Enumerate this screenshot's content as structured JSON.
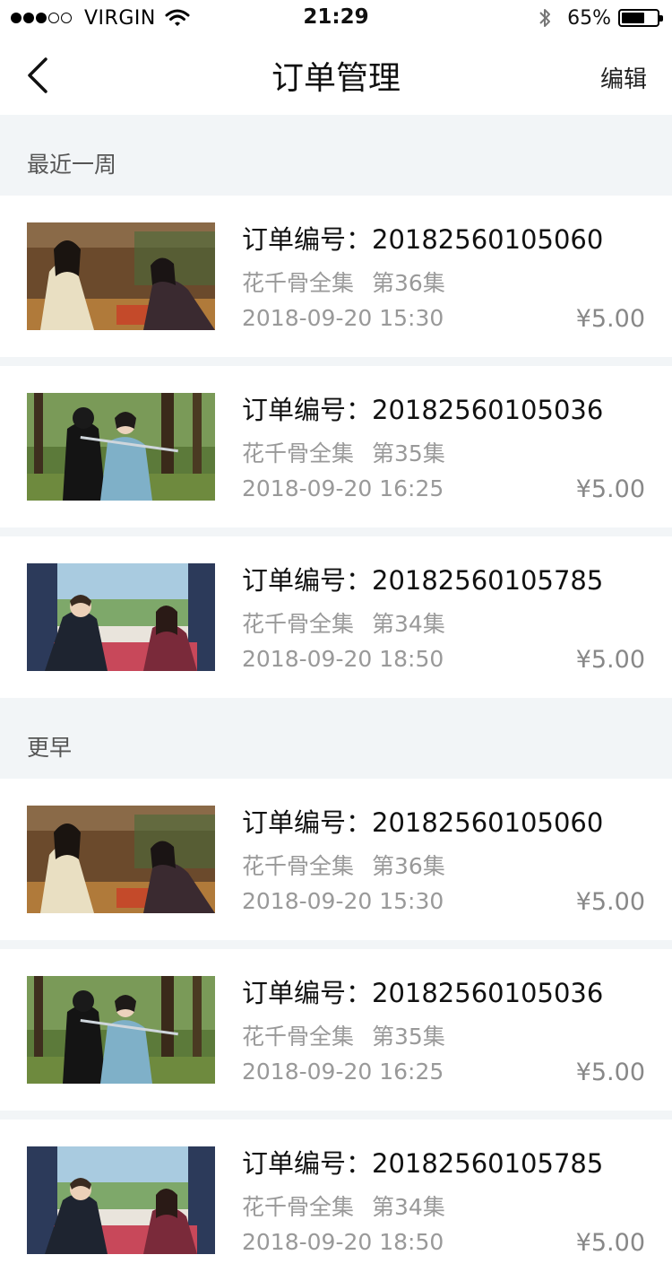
{
  "status_bar": {
    "carrier": "VIRGIN",
    "time": "21:29",
    "battery_percent": "65%",
    "battery_level": 0.65,
    "signal_bars": 3
  },
  "nav": {
    "title": "订单管理",
    "edit_label": "编辑",
    "back_icon": "chevron-left-icon"
  },
  "sections": [
    {
      "title": "最近一周",
      "orders": [
        {
          "order_label": "订单编号：20182560105060",
          "series": "花千骨全集",
          "episode": "第36集",
          "datetime": "2018-09-20 15:30",
          "price": "¥5.00",
          "thumb": "a"
        },
        {
          "order_label": "订单编号：20182560105036",
          "series": "花千骨全集",
          "episode": "第35集",
          "datetime": "2018-09-20 16:25",
          "price": "¥5.00",
          "thumb": "b"
        },
        {
          "order_label": "订单编号：20182560105785",
          "series": "花千骨全集",
          "episode": "第34集",
          "datetime": "2018-09-20 18:50",
          "price": "¥5.00",
          "thumb": "c"
        }
      ]
    },
    {
      "title": "更早",
      "orders": [
        {
          "order_label": "订单编号：20182560105060",
          "series": "花千骨全集",
          "episode": "第36集",
          "datetime": "2018-09-20 15:30",
          "price": "¥5.00",
          "thumb": "a"
        },
        {
          "order_label": "订单编号：20182560105036",
          "series": "花千骨全集",
          "episode": "第35集",
          "datetime": "2018-09-20 16:25",
          "price": "¥5.00",
          "thumb": "b"
        },
        {
          "order_label": "订单编号：20182560105785",
          "series": "花千骨全集",
          "episode": "第34集",
          "datetime": "2018-09-20 18:50",
          "price": "¥5.00",
          "thumb": "c"
        }
      ]
    }
  ],
  "colors": {
    "background": "#f2f5f7",
    "primary_text": "#111111",
    "secondary_text": "#999999",
    "price_text": "#888888"
  }
}
